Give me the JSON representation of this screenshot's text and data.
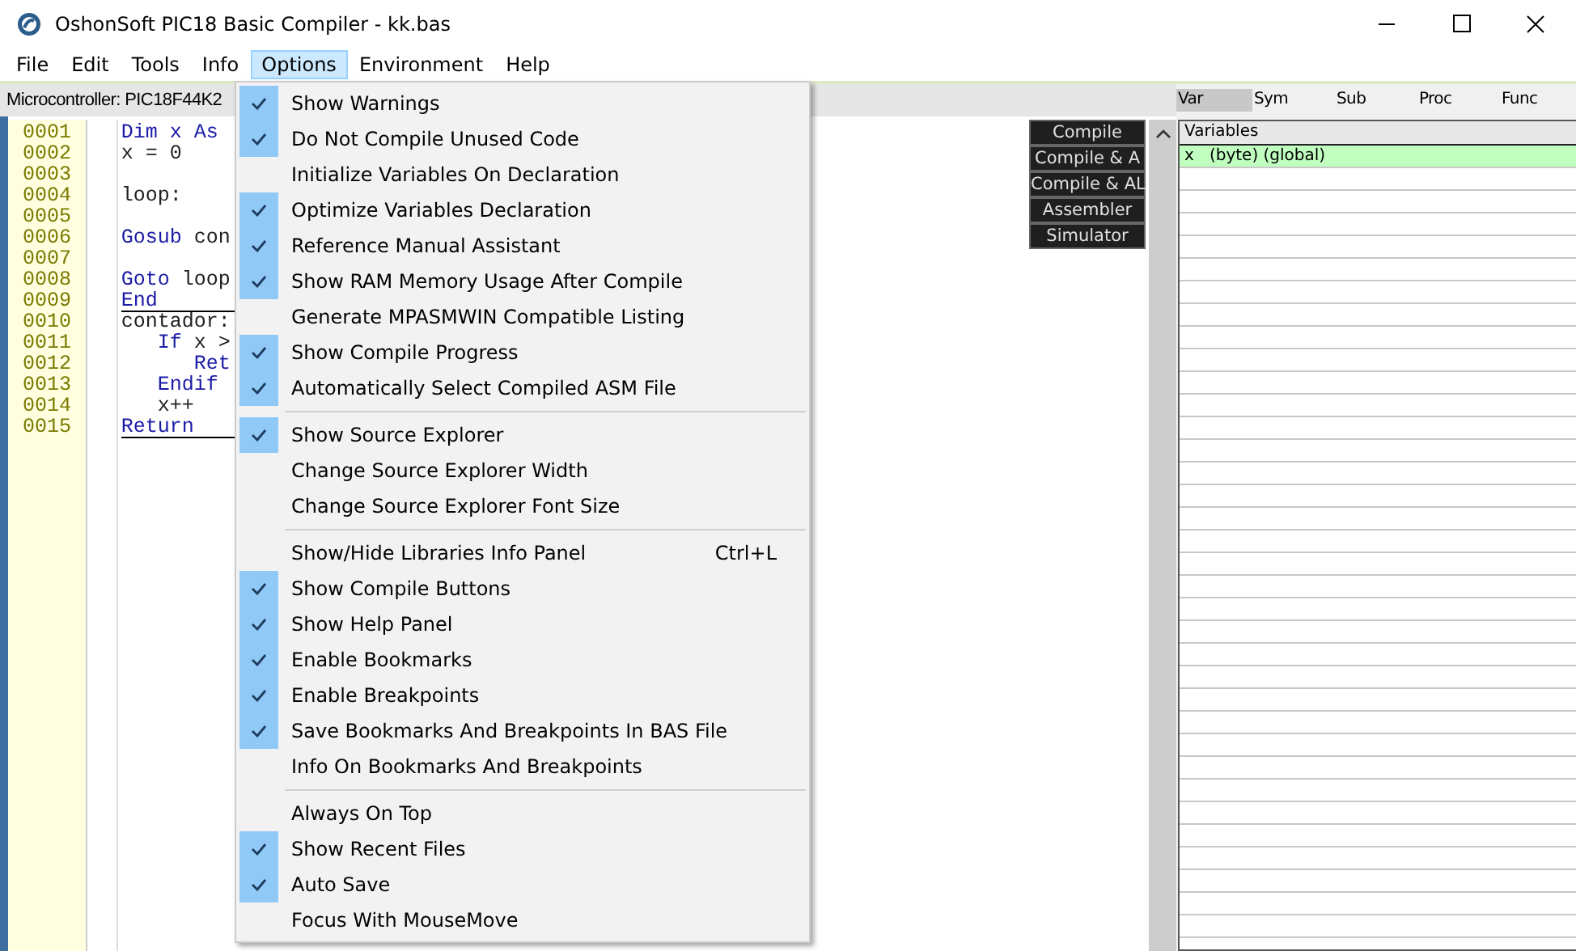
{
  "window": {
    "title": "OshonSoft PIC18 Basic Compiler - kk.bas"
  },
  "menu_bar": [
    {
      "label": "File",
      "selected": false
    },
    {
      "label": "Edit",
      "selected": false
    },
    {
      "label": "Tools",
      "selected": false
    },
    {
      "label": "Info",
      "selected": false
    },
    {
      "label": "Options",
      "selected": true
    },
    {
      "label": "Environment",
      "selected": false
    },
    {
      "label": "Help",
      "selected": false
    }
  ],
  "microcontroller": "Microcontroller: PIC18F44K2",
  "editor": {
    "lines": [
      {
        "number": "0001",
        "underlined": false,
        "code": [
          {
            "text": "Dim x As",
            "keyword": true
          }
        ]
      },
      {
        "number": "0002",
        "underlined": false,
        "code": [
          {
            "text": "x = 0",
            "keyword": false
          }
        ]
      },
      {
        "number": "0003",
        "underlined": false
      },
      {
        "number": "0004",
        "underlined": false,
        "code": [
          {
            "text": "loop:",
            "keyword": false
          }
        ]
      },
      {
        "number": "0005",
        "underlined": false
      },
      {
        "number": "0006",
        "underlined": false,
        "code": [
          {
            "text": "Gosub",
            "keyword": true
          },
          {
            "text": " con",
            "keyword": false
          }
        ]
      },
      {
        "number": "0007",
        "underlined": false
      },
      {
        "number": "0008",
        "underlined": false,
        "code": [
          {
            "text": "Goto",
            "keyword": true
          },
          {
            "text": " loop",
            "keyword": false
          }
        ]
      },
      {
        "number": "0009",
        "underlined": true,
        "code": [
          {
            "text": "End",
            "keyword": true
          }
        ]
      },
      {
        "number": "0010",
        "underlined": false,
        "code": [
          {
            "text": "contador:",
            "keyword": false
          }
        ]
      },
      {
        "number": "0011",
        "underlined": false,
        "code": [
          {
            "text": "   If",
            "keyword": true
          },
          {
            "text": " x >",
            "keyword": false
          }
        ]
      },
      {
        "number": "0012",
        "underlined": false,
        "code": [
          {
            "text": "      Ret",
            "keyword": true
          }
        ]
      },
      {
        "number": "0013",
        "underlined": false,
        "code": [
          {
            "text": "   Endif",
            "keyword": true
          }
        ]
      },
      {
        "number": "0014",
        "underlined": false,
        "code": [
          {
            "text": "   x++",
            "keyword": false
          }
        ]
      },
      {
        "number": "0015",
        "underlined": true,
        "code": [
          {
            "text": "Return",
            "keyword": true
          }
        ]
      }
    ]
  },
  "compile_buttons": [
    "Compile",
    "Compile & A",
    "Compile & AL",
    "Assembler",
    "Simulator"
  ],
  "explorer": {
    "tabs": [
      {
        "label": "Var",
        "selected": true
      },
      {
        "label": "Sym",
        "selected": false
      },
      {
        "label": "Sub",
        "selected": false
      },
      {
        "label": "Proc",
        "selected": false
      },
      {
        "label": "Func",
        "selected": false
      }
    ],
    "header": "Variables",
    "rows": [
      "x   (byte) (global)"
    ]
  },
  "options_menu": [
    {
      "kind": "item",
      "label": "Show Warnings",
      "checked": true
    },
    {
      "kind": "item",
      "label": "Do Not Compile Unused Code",
      "checked": true
    },
    {
      "kind": "item",
      "label": "Initialize Variables On Declaration",
      "checked": false
    },
    {
      "kind": "item",
      "label": "Optimize Variables Declaration",
      "checked": true
    },
    {
      "kind": "item",
      "label": "Reference Manual Assistant",
      "checked": true
    },
    {
      "kind": "item",
      "label": "Show RAM Memory Usage After Compile",
      "checked": true
    },
    {
      "kind": "item",
      "label": "Generate MPASMWIN Compatible Listing",
      "checked": false
    },
    {
      "kind": "item",
      "label": "Show Compile Progress",
      "checked": true
    },
    {
      "kind": "item",
      "label": "Automatically Select Compiled ASM File",
      "checked": true
    },
    {
      "kind": "separator"
    },
    {
      "kind": "item",
      "label": "Show Source Explorer",
      "checked": true
    },
    {
      "kind": "item",
      "label": "Change Source Explorer Width",
      "checked": false
    },
    {
      "kind": "item",
      "label": "Change Source Explorer Font Size",
      "checked": false
    },
    {
      "kind": "separator"
    },
    {
      "kind": "item",
      "label": "Show/Hide Libraries Info Panel",
      "checked": false,
      "shortcut": "Ctrl+L"
    },
    {
      "kind": "item",
      "label": "Show Compile Buttons",
      "checked": true
    },
    {
      "kind": "item",
      "label": "Show Help Panel",
      "checked": true
    },
    {
      "kind": "item",
      "label": "Enable Bookmarks",
      "checked": true
    },
    {
      "kind": "item",
      "label": "Enable Breakpoints",
      "checked": true
    },
    {
      "kind": "item",
      "label": "Save Bookmarks And Breakpoints In BAS File",
      "checked": true
    },
    {
      "kind": "item",
      "label": "Info On Bookmarks And Breakpoints",
      "checked": false
    },
    {
      "kind": "separator"
    },
    {
      "kind": "item",
      "label": "Always On Top",
      "checked": false
    },
    {
      "kind": "item",
      "label": "Show Recent Files",
      "checked": true
    },
    {
      "kind": "item",
      "label": "Auto Save",
      "checked": true
    },
    {
      "kind": "item",
      "label": "Focus With MouseMove",
      "checked": false
    }
  ]
}
